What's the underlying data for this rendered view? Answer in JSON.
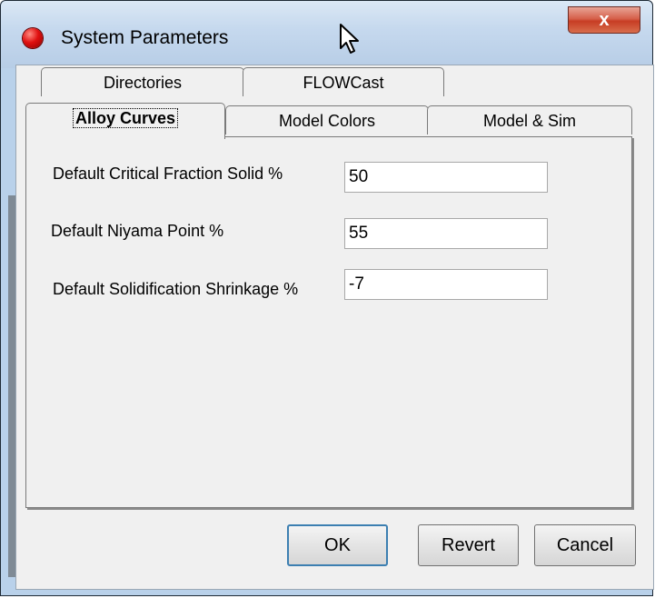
{
  "window": {
    "title": "System Parameters",
    "close_label": "x"
  },
  "tabs": {
    "row1": [
      {
        "label": "Directories"
      },
      {
        "label": "FLOWCast"
      }
    ],
    "row2": [
      {
        "label": "Alloy Curves",
        "active": true
      },
      {
        "label": "Model Colors"
      },
      {
        "label": "Model & Sim"
      }
    ]
  },
  "fields": [
    {
      "label": "Default Critical Fraction Solid %",
      "value": "50"
    },
    {
      "label": "Default Niyama Point %",
      "value": "55"
    },
    {
      "label": "Default Solidification Shrinkage %",
      "value": "-7"
    }
  ],
  "buttons": {
    "ok": "OK",
    "revert": "Revert",
    "cancel": "Cancel"
  }
}
